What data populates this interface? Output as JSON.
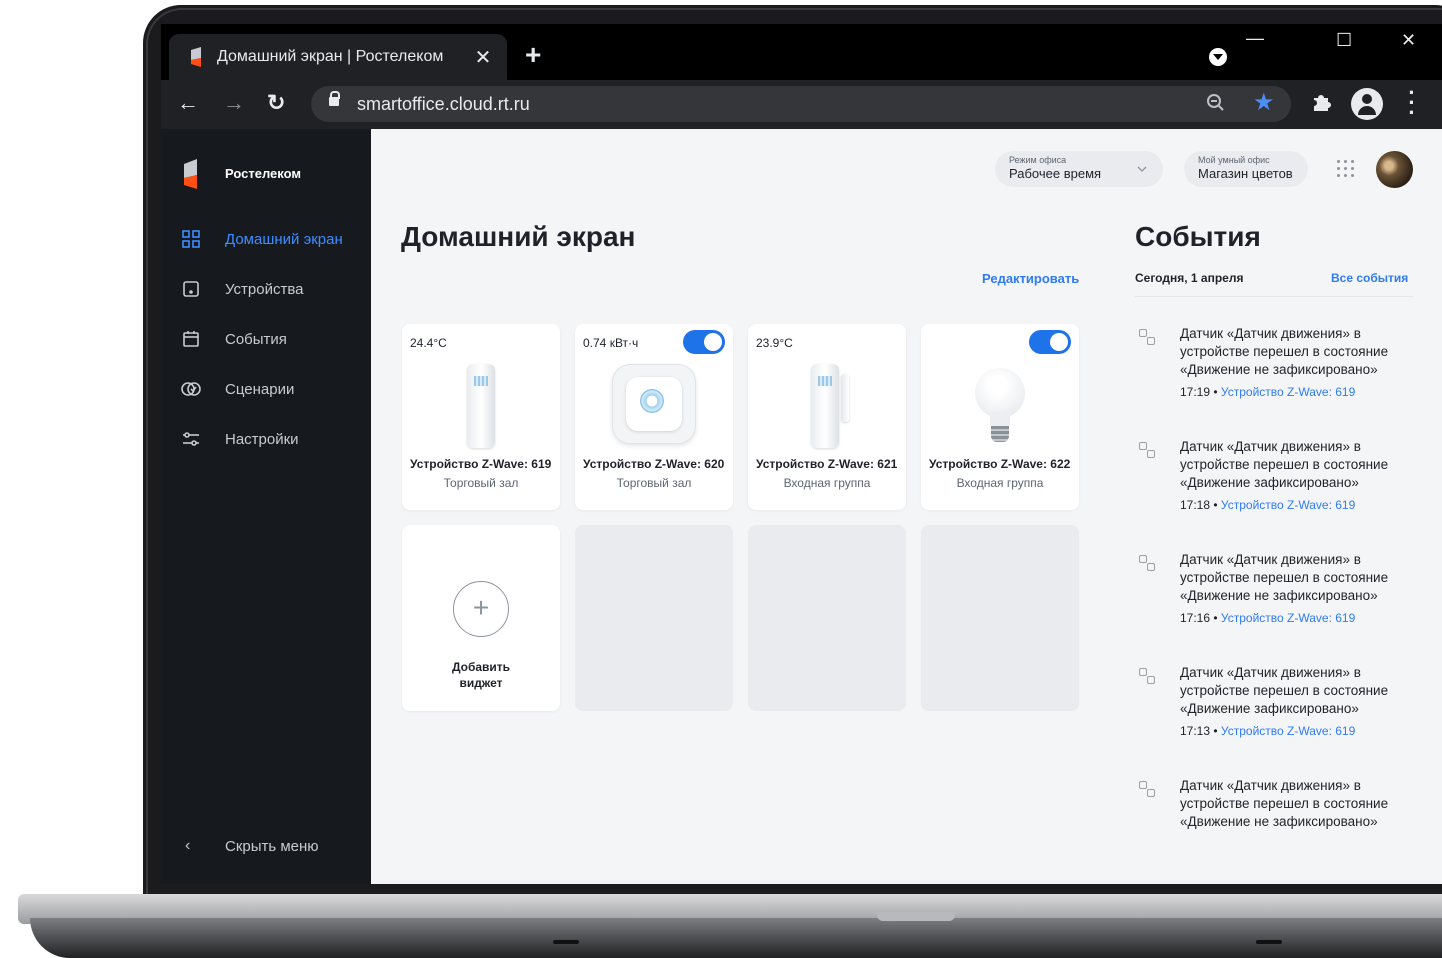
{
  "browser": {
    "tab_title": "Домашний экран | Ростелеком",
    "tab_close": "✕",
    "new_tab": "+",
    "minimize": "—",
    "maximize": "☐",
    "close": "✕",
    "back": "←",
    "forward": "→",
    "reload": "↻",
    "url": "smartoffice.cloud.rt.ru",
    "bookmarked": true,
    "accent_color": "#4c8df6"
  },
  "sidebar": {
    "brand": "Ростелеком",
    "items": [
      {
        "label": "Домашний экран",
        "icon": "grid-icon",
        "active": true
      },
      {
        "label": "Устройства",
        "icon": "device-icon",
        "active": false
      },
      {
        "label": "События",
        "icon": "calendar-icon",
        "active": false
      },
      {
        "label": "Сценарии",
        "icon": "scenario-icon",
        "active": false
      },
      {
        "label": "Настройки",
        "icon": "sliders-icon",
        "active": false
      }
    ],
    "hide_menu": "Скрыть меню",
    "hide_chevron": "‹"
  },
  "header": {
    "office_mode": {
      "caption": "Режим офиса",
      "value": "Рабочее время"
    },
    "my_office": {
      "caption": "Мой умный офис",
      "value": "Магазин цветов"
    }
  },
  "home": {
    "title": "Домашний экран",
    "edit_label": "Редактировать",
    "widgets": [
      {
        "value": "24.4°C",
        "toggle": false,
        "name": "Устройство Z-Wave: 619",
        "room": "Торговый зал",
        "image": "motion-sensor"
      },
      {
        "value": "0.74 кВт·ч",
        "toggle": true,
        "name": "Устройство Z-Wave: 620",
        "room": "Торговый зал",
        "image": "smart-plug"
      },
      {
        "value": "23.9°C",
        "toggle": false,
        "name": "Устройство Z-Wave: 621",
        "room": "Входная группа",
        "image": "door-sensor"
      },
      {
        "value": "",
        "toggle": true,
        "name": "Устройство Z-Wave: 622",
        "room": "Входная группа",
        "image": "light-bulb"
      }
    ],
    "add_widget": {
      "plus": "+",
      "label_line1": "Добавить",
      "label_line2": "виджет"
    }
  },
  "events": {
    "title": "События",
    "date": "Сегодня, 1 апреля",
    "all_label": "Все события",
    "items": [
      {
        "text": "Датчик «Датчик движения» в устройстве перешел в состояние «Движение не зафиксировано»",
        "time": "17:19",
        "device": "Устройство Z-Wave: 619"
      },
      {
        "text": "Датчик «Датчик движения» в устройстве перешел в состояние «Движение зафиксировано»",
        "time": "17:18",
        "device": "Устройство Z-Wave: 619"
      },
      {
        "text": "Датчик «Датчик движения» в устройстве перешел в состояние «Движение не зафиксировано»",
        "time": "17:16",
        "device": "Устройство Z-Wave: 619"
      },
      {
        "text": "Датчик «Датчик движения» в устройстве перешел в состояние «Движение зафиксировано»",
        "time": "17:13",
        "device": "Устройство Z-Wave: 619"
      },
      {
        "text": "Датчик «Датчик движения» в устройстве перешел в состояние «Движение не зафиксировано»",
        "time": "",
        "device": ""
      }
    ]
  }
}
